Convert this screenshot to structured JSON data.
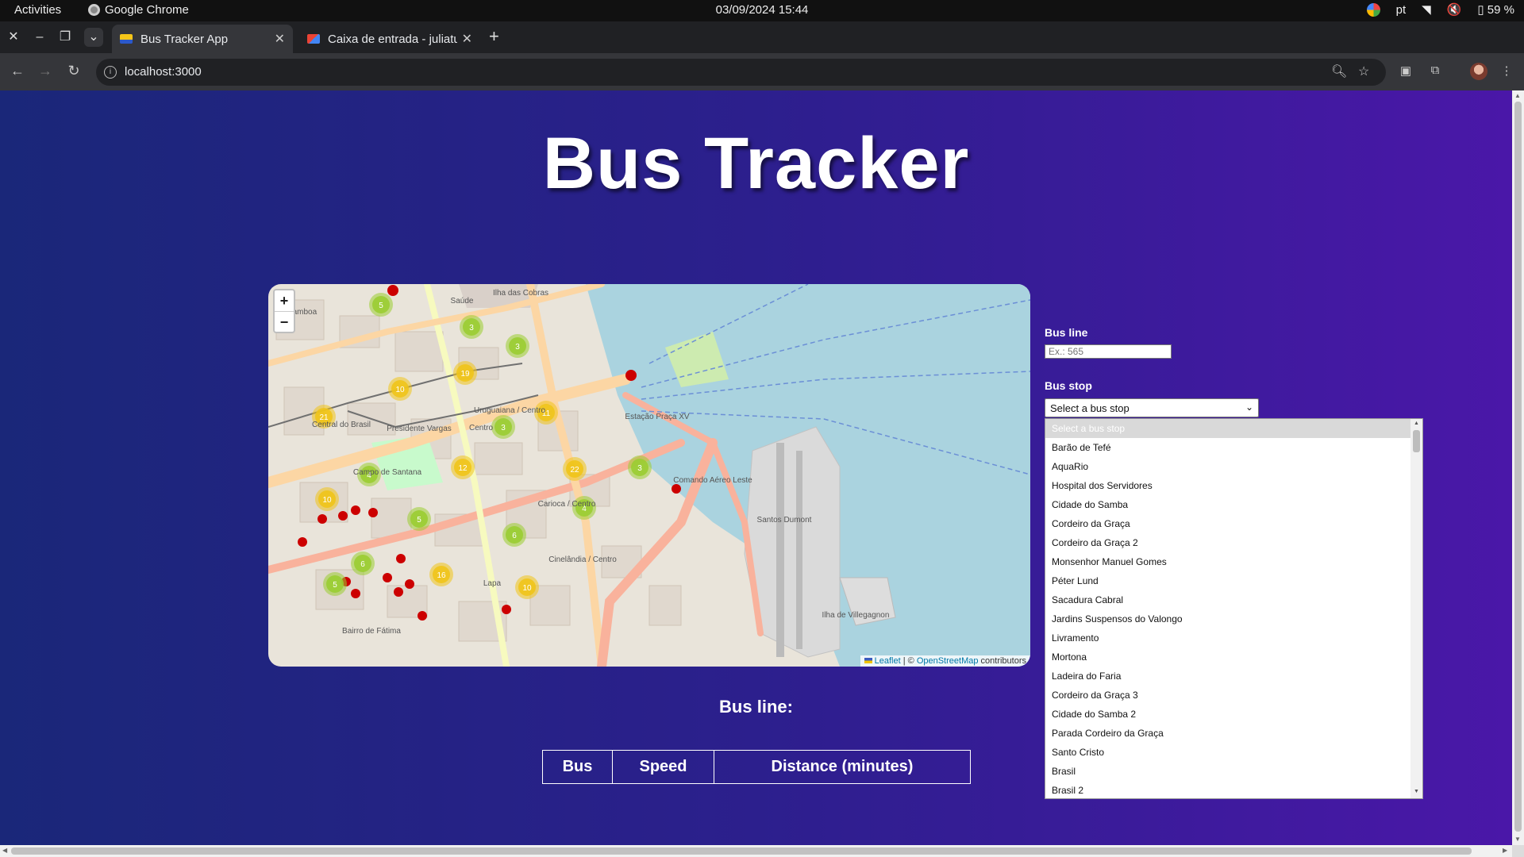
{
  "system_bar": {
    "activities": "Activities",
    "app_name": "Google Chrome",
    "datetime": "03/09/2024 15:44",
    "language": "pt",
    "battery": "59 %"
  },
  "browser": {
    "tabs": [
      {
        "title": "Bus Tracker App",
        "active": true
      },
      {
        "title": "Caixa de entrada - juliatura",
        "active": false
      }
    ],
    "url": "localhost:3000"
  },
  "page": {
    "title": "Bus Tracker",
    "bus_line_label": "Bus line",
    "bus_line_placeholder": "Ex.: 565",
    "bus_stop_label": "Bus stop",
    "bus_stop_selected": "Select a bus stop",
    "bus_stop_options": [
      "Select a bus stop",
      "Barão de Tefé",
      "AquaRio",
      "Hospital dos Servidores",
      "Cidade do Samba",
      "Cordeiro da Graça",
      "Cordeiro da Graça 2",
      "Monsenhor Manuel Gomes",
      "Péter Lund",
      "Sacadura Cabral",
      "Jardins Suspensos do Valongo",
      "Livramento",
      "Mortona",
      "Ladeira do Faria",
      "Cordeiro da Graça 3",
      "Cidade do Samba 2",
      "Parada Cordeiro da Graça",
      "Santo Cristo",
      "Brasil",
      "Brasil 2"
    ],
    "results_title": "Bus line:",
    "table_headers": [
      "Bus",
      "Speed",
      "Distance (minutes)"
    ]
  },
  "map": {
    "zoom_in": "+",
    "zoom_out": "−",
    "attribution_leaflet": "Leaflet",
    "attribution_sep": " | © ",
    "attribution_osm": "OpenStreetMap",
    "attribution_tail": " contributors",
    "place_labels": [
      "Saúde",
      "Gamboa",
      "Ilha das Cobras",
      "Centro",
      "Central do Brasil",
      "Uruguaiana / Centro",
      "Carioca / Centro",
      "Cinelândia / Centro",
      "Lapa",
      "Santos Dumont",
      "Ilha de Villegagnon",
      "Estação Praça XV",
      "Presidente Vargas",
      "Bairro de Fátima",
      "Campo de Santana",
      "Comando Aéreo Leste"
    ],
    "clusters": [
      {
        "label": "5",
        "color": "#9acd32"
      },
      {
        "label": "3",
        "color": "#9acd32"
      },
      {
        "label": "3",
        "color": "#9acd32"
      },
      {
        "label": "19",
        "color": "#f0c419"
      },
      {
        "label": "10",
        "color": "#f0c419"
      },
      {
        "label": "11",
        "color": "#f0c419"
      },
      {
        "label": "21",
        "color": "#f0c419"
      },
      {
        "label": "3",
        "color": "#9acd32"
      },
      {
        "label": "12",
        "color": "#f0c419"
      },
      {
        "label": "22",
        "color": "#f0c419"
      },
      {
        "label": "3",
        "color": "#9acd32"
      },
      {
        "label": "4",
        "color": "#9acd32"
      },
      {
        "label": "10",
        "color": "#f0c419"
      },
      {
        "label": "4",
        "color": "#9acd32"
      },
      {
        "label": "5",
        "color": "#9acd32"
      },
      {
        "label": "6",
        "color": "#9acd32"
      },
      {
        "label": "6",
        "color": "#9acd32"
      },
      {
        "label": "16",
        "color": "#f0c419"
      },
      {
        "label": "5",
        "color": "#9acd32"
      },
      {
        "label": "10",
        "color": "#f0c419"
      }
    ]
  }
}
